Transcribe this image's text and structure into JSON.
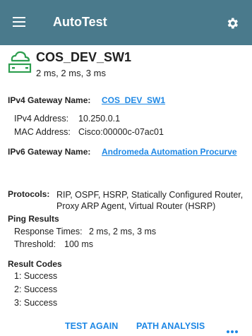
{
  "app": {
    "title": "AutoTest"
  },
  "colors": {
    "appbar": "#4a7a8c",
    "accent": "#1e88e5",
    "device_icon": "#2e9e4f"
  },
  "icons": {
    "menu": "hamburger-menu",
    "settings": "gear",
    "device": "cloud-switch",
    "more": "ellipsis"
  },
  "device": {
    "name": "COS_DEV_SW1",
    "times": "2 ms, 2 ms, 3 ms"
  },
  "ipv4": {
    "gateway_label": "IPv4 Gateway Name:",
    "gateway_value": "COS_DEV_SW1",
    "address_label": "IPv4 Address:",
    "address_value": "10.250.0.1",
    "mac_label": "MAC Address:",
    "mac_value": "Cisco:00000c-07ac01"
  },
  "ipv6": {
    "gateway_label": "IPv6 Gateway Name:",
    "gateway_value": "Andromeda Automation Procurve"
  },
  "protocols": {
    "label": "Protocols:",
    "value": "RIP, OSPF, HSRP, Statically Configured Router, Proxy ARP Agent, Virtual Router (HSRP)"
  },
  "ping": {
    "title": "Ping Results",
    "response_label": "Response Times:",
    "response_value": "2 ms,  2 ms,  3 ms",
    "threshold_label": "Threshold:",
    "threshold_value": "100 ms"
  },
  "result_codes": {
    "title": "Result Codes",
    "items": [
      "1: Success",
      "2: Success",
      "3: Success"
    ]
  },
  "footer": {
    "test_again": "TEST AGAIN",
    "path_analysis": "PATH ANALYSIS"
  }
}
